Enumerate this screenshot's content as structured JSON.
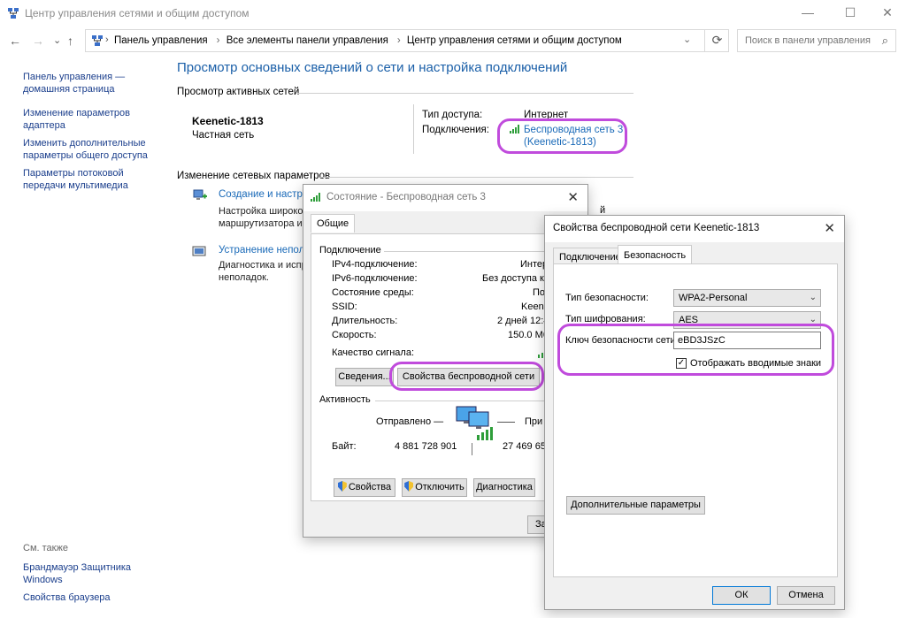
{
  "window": {
    "title": "Центр управления сетями и общим доступом",
    "min": "—",
    "max": "☐",
    "close": "✕"
  },
  "nav": {
    "back": "←",
    "forward": "→",
    "dropdown": "⌄",
    "up": "↑"
  },
  "breadcrumbs": [
    "Панель управления",
    "Все элементы панели управления",
    "Центр управления сетями и общим доступом"
  ],
  "search": {
    "placeholder": "Поиск в панели управления"
  },
  "sidebar": {
    "items": [
      "Панель управления — домашняя страница",
      "Изменение параметров адаптера",
      "Изменить дополнительные параметры общего доступа",
      "Параметры потоковой передачи мультимедиа"
    ],
    "see_also": "См. также",
    "see_also_items": [
      "Брандмауэр Защитника Windows",
      "Свойства браузера"
    ]
  },
  "main": {
    "heading": "Просмотр основных сведений о сети и настройка подключений",
    "active_networks": "Просмотр активных сетей",
    "network_name": "Keenetic-1813",
    "network_type": "Частная сеть",
    "access_type_label": "Тип доступа:",
    "access_type_value": "Интернет",
    "connections_label": "Подключения:",
    "connection_link_1": "Беспроводная сеть 3",
    "connection_link_2": "(Keenetic-1813)",
    "change_settings": "Изменение сетевых параметров",
    "task1_link": "Создание и настрой",
    "task1_desc_1": "Настройка широко",
    "task1_desc_2": "маршрутизатора и",
    "task2_link": "Устранение непола",
    "task2_desc_1": "Диагностика и испр",
    "task2_desc_2": "неполадок."
  },
  "status_dialog": {
    "title": "Состояние - Беспроводная сеть 3",
    "tab": "Общие",
    "connection_group": "Подключение",
    "rows": [
      {
        "label": "IPv4-подключение:",
        "value": "Интер"
      },
      {
        "label": "IPv6-подключение:",
        "value": "Без доступа к с"
      },
      {
        "label": "Состояние среды:",
        "value": "Подклю"
      },
      {
        "label": "SSID:",
        "value": "Keenetic-1"
      },
      {
        "label": "Длительность:",
        "value": "2 дней 12:4"
      },
      {
        "label": "Скорость:",
        "value": "150.0 Мб"
      }
    ],
    "signal_label": "Качество сигнала:",
    "details_button": "Сведения...",
    "wireless_props_button": "Свойства беспроводной сети",
    "activity_group": "Активность",
    "sent_label": "Отправлено —",
    "received_label": "При",
    "bytes_label": "Байт:",
    "bytes_sent": "4 881 728 901",
    "bytes_received": "27 469 658",
    "properties_button": "Свойства",
    "disable_button": "Отключить",
    "diagnose_button": "Диагностика",
    "close_button": "За"
  },
  "props_dialog": {
    "title": "Свойства беспроводной сети Keenetic-1813",
    "tab_connection": "Подключение",
    "tab_security": "Безопасность",
    "security_type_label": "Тип безопасности:",
    "security_type_value": "WPA2-Personal",
    "encryption_label": "Тип шифрования:",
    "encryption_value": "AES",
    "key_label": "Ключ безопасности сети",
    "key_value": "eBD3JSzC",
    "show_chars_label": "Отображать вводимые знаки",
    "show_chars_checked": "✓",
    "advanced_button": "Дополнительные параметры",
    "ok_button": "ОК",
    "cancel_button": "Отмена"
  },
  "colors": {
    "highlight": "#c04bdc",
    "link": "#1a6ab8",
    "heading": "#1a5fa8"
  }
}
